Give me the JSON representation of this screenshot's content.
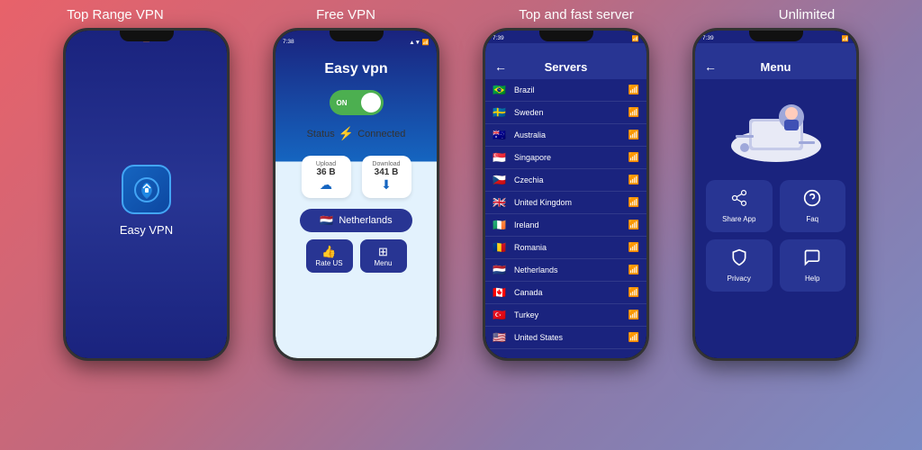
{
  "labels": {
    "label1": "Top Range VPN",
    "label2": "Free VPN",
    "label3": "Top and fast server",
    "label4": "Unlimited"
  },
  "phone1": {
    "app_name": "Easy VPN"
  },
  "phone2": {
    "title": "Easy vpn",
    "toggle_text": "ON",
    "status_label": "Status",
    "status_value": "Connected",
    "upload_label": "Upload",
    "upload_value": "36 B",
    "download_label": "Download",
    "download_value": "341 B",
    "country": "Netherlands",
    "btn1_label": "Rate US",
    "btn2_label": "Menu",
    "time": "7:38",
    "signal": "▲▼ ⬛ 📶"
  },
  "phone3": {
    "header": "Servers",
    "time": "7:39",
    "servers": [
      {
        "flag": "🇧🇷",
        "name": "Brazil"
      },
      {
        "flag": "🇸🇪",
        "name": "Sweden"
      },
      {
        "flag": "🇦🇺",
        "name": "Australia"
      },
      {
        "flag": "🇸🇬",
        "name": "Singapore"
      },
      {
        "flag": "🇨🇿",
        "name": "Czechia"
      },
      {
        "flag": "🇬🇧",
        "name": "United Kingdom"
      },
      {
        "flag": "🇮🇪",
        "name": "Ireland"
      },
      {
        "flag": "🇷🇴",
        "name": "Romania"
      },
      {
        "flag": "🇳🇱",
        "name": "Netherlands"
      },
      {
        "flag": "🇨🇦",
        "name": "Canada"
      },
      {
        "flag": "🇹🇷",
        "name": "Turkey"
      },
      {
        "flag": "🇺🇸",
        "name": "United States"
      }
    ]
  },
  "phone4": {
    "header": "Menu",
    "time": "7:39",
    "menu_items": [
      {
        "icon": "share",
        "label": "Share App"
      },
      {
        "icon": "help",
        "label": "Faq"
      },
      {
        "icon": "lock",
        "label": "Privacy"
      },
      {
        "icon": "support",
        "label": "Help"
      }
    ]
  }
}
